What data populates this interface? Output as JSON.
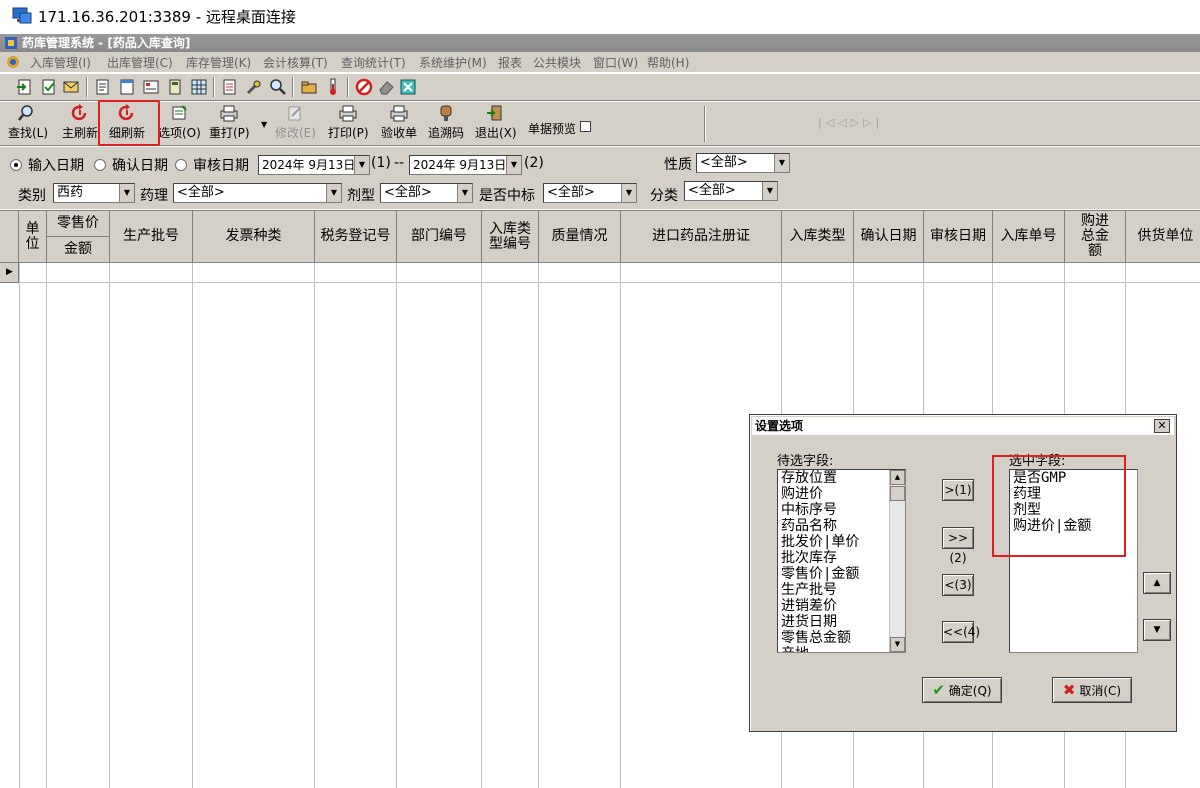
{
  "rdp": {
    "title": "171.16.36.201:3389 - 远程桌面连接"
  },
  "app": {
    "title": "药库管理系统 - [药品入库查询]"
  },
  "menu": [
    "入库管理(I)",
    "出库管理(C)",
    "库存管理(K)",
    "会计核算(T)",
    "查询统计(T)",
    "系统维护(M)",
    "报表",
    "公共模块",
    "窗口(W)",
    "帮助(H)"
  ],
  "toolbar": {
    "find": "查找(L)",
    "main_refresh": "主刷新",
    "fine_refresh": "细刷新",
    "options": "选项(O)",
    "reprint": "重打(P)",
    "modify": "修改(E)",
    "print": "打印(P)",
    "receipt": "验收单",
    "trace_code": "追溯码",
    "exit": "退出(X)",
    "preview_label": "单据预览"
  },
  "filters": {
    "date_options": [
      "输入日期",
      "确认日期",
      "审核日期"
    ],
    "date_from": "2024年 9月13日",
    "date_from_key": "(1)",
    "dash": "--",
    "date_to": "2024年 9月13日",
    "date_to_key": "(2)",
    "nature_label": "性质",
    "nature_value": "<全部>",
    "category_label": "类别",
    "category_value": "西药",
    "pharmacology_label": "药理",
    "pharmacology_value": "<全部>",
    "dosage_label": "剂型",
    "dosage_value": "<全部>",
    "bid_label": "是否中标",
    "bid_value": "<全部>",
    "class_label": "分类",
    "class_value": "<全部>"
  },
  "grid": {
    "headers": {
      "unit": "单位",
      "retail_price": "零售价",
      "amount": "金额",
      "batch": "生产批号",
      "invoice_type": "发票种类",
      "tax_reg": "税务登记号",
      "dept_code": "部门编号",
      "in_type_code": "入库类型编号",
      "quality": "质量情况",
      "import_reg": "进口药品注册证",
      "in_type": "入库类型",
      "confirm_date": "确认日期",
      "audit_date": "审核日期",
      "in_no": "入库单号",
      "purchase_total": "购进总金额",
      "supplier": "供货单位"
    }
  },
  "dialog": {
    "title": "设置选项",
    "available_label": "待选字段:",
    "selected_label": "选中字段:",
    "available_fields": [
      "存放位置",
      "购进价",
      "中标序号",
      "药品名称",
      "批发价|单价",
      "批次库存",
      "零售价|金额",
      "生产批号",
      "进销差价",
      "进货日期",
      "零售总金额",
      "产地"
    ],
    "selected_fields": [
      "是否GMP",
      "药理",
      "剂型",
      "购进价|金额"
    ],
    "btn_add": ">(1)",
    "btn_add_all": ">>(2)",
    "btn_remove": "<(3)",
    "btn_remove_all": "<<(4)",
    "btn_ok": "确定(Q)",
    "btn_cancel": "取消(C)"
  }
}
